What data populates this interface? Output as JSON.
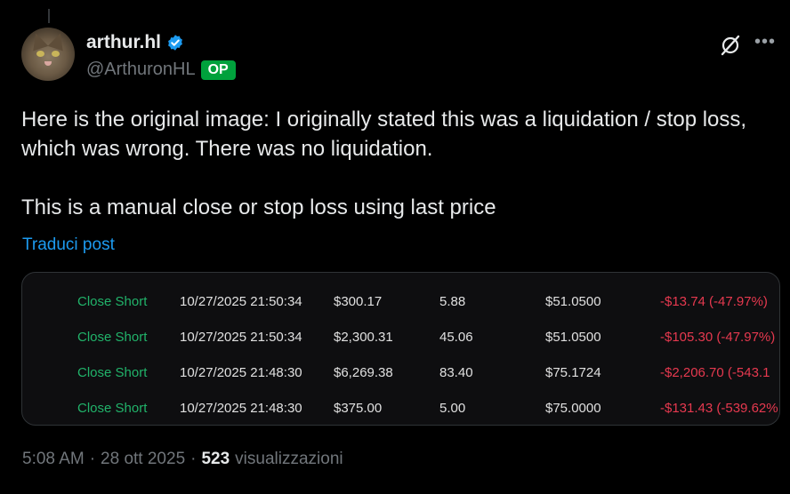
{
  "author": {
    "display_name": "arthur.hl",
    "handle": "@ArthuronHL",
    "badge": "OP"
  },
  "tweet": {
    "paragraph_1": "Here is the original image: I originally stated this was a liquidation / stop loss, which was wrong. There was no liquidation.",
    "paragraph_2": "This is a manual close or stop loss using last price",
    "translate_link": "Traduci post"
  },
  "trades": [
    {
      "direction": "Close Short",
      "time": "10/27/2025 21:50:34",
      "value": "$300.17",
      "size": "5.88",
      "price": "$51.0500",
      "pnl": "-$13.74 (-47.97%)"
    },
    {
      "direction": "Close Short",
      "time": "10/27/2025 21:50:34",
      "value": "$2,300.31",
      "size": "45.06",
      "price": "$51.0500",
      "pnl": "-$105.30 (-47.97%)"
    },
    {
      "direction": "Close Short",
      "time": "10/27/2025 21:48:30",
      "value": "$6,269.38",
      "size": "83.40",
      "price": "$75.1724",
      "pnl": "-$2,206.70 (-543.1"
    },
    {
      "direction": "Close Short",
      "time": "10/27/2025 21:48:30",
      "value": "$375.00",
      "size": "5.00",
      "price": "$75.0000",
      "pnl": "-$131.43 (-539.62%"
    }
  ],
  "footer": {
    "time": "5:08 AM",
    "separator": "·",
    "date": "28 ott 2025",
    "views_count": "523",
    "views_label": "visualizzazioni"
  },
  "icons": {
    "verified": "verified-badge-icon",
    "grok": "grok-icon",
    "more": "more-icon"
  },
  "colors": {
    "accent": "#1d9bf0",
    "op_badge": "#00a13c",
    "trade_direction": "#21b36a",
    "pnl_negative": "#e6394f"
  }
}
